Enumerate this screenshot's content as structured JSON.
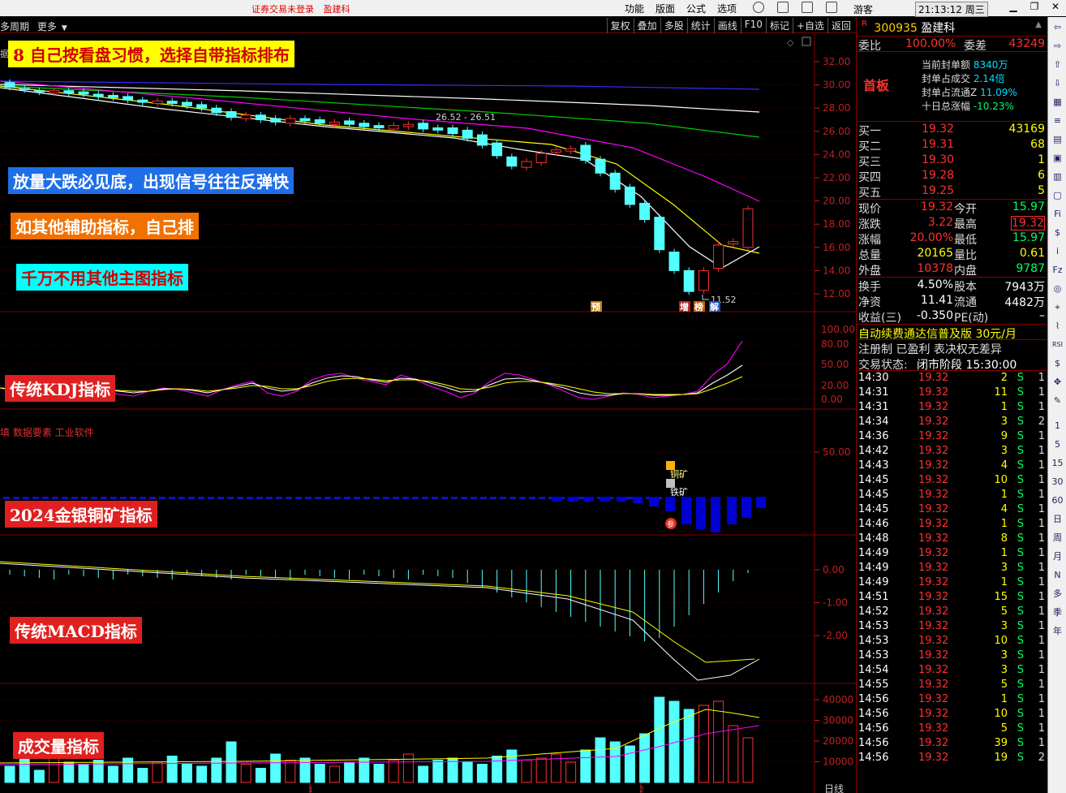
{
  "titlebar": {
    "status_text": "证券交易未登录",
    "stock_name": "盈建科",
    "menu": [
      "功能",
      "版面",
      "公式",
      "选项"
    ],
    "guest": "游客",
    "clock": "21:13:12 周三"
  },
  "toolbar": {
    "left": [
      "多周期",
      "更多"
    ],
    "right": [
      "复权",
      "叠加",
      "多股",
      "统计",
      "画线",
      "F10",
      "标记",
      "+自选",
      "返回"
    ]
  },
  "annotations": {
    "a8": "8  自己按看盘习惯，选择自带指标排布",
    "volume_drop": "放量大跌必见底，出现信号往往反弹快",
    "other_aux": "如其他辅助指标，自己排",
    "no_main": "千万不用其他主图指标",
    "kdj": "传统KDJ指标",
    "copper": "2024金银铜矿指标",
    "macd": "传统MACD指标",
    "vol": "成交量指标"
  },
  "chart_labels": {
    "main_partial": "据",
    "price_mark_top": "26.52 - 26.51",
    "price_mark_low": "11.52",
    "badges": [
      "预",
      "增",
      "榜",
      "解"
    ],
    "copper_source": "填 数据要素 工业软件",
    "copper_label": "铜矿",
    "iron_label": "铁矿",
    "ref_badge": "参",
    "axis_bottom": [
      "1",
      "2"
    ],
    "period": "日线"
  },
  "axes": {
    "main": [
      "32.00",
      "30.00",
      "28.00",
      "26.00",
      "24.00",
      "22.00",
      "20.00",
      "18.00",
      "16.00",
      "14.00",
      "12.00"
    ],
    "kdj": [
      "100.00",
      "80.00",
      "50.00",
      "20.00",
      "0.00"
    ],
    "copper": [
      "50.00"
    ],
    "macd": [
      "0.00",
      "-1.00",
      "-2.00"
    ],
    "vol": [
      "40000",
      "30000",
      "20000",
      "10000"
    ]
  },
  "panel": {
    "code": "300935",
    "name": "盈建科",
    "r_mark": "R",
    "weibi_label": "委比",
    "weibi": "100.00%",
    "weicha_label": "委差",
    "weicha": "43249",
    "first_board": "首板",
    "info": [
      {
        "k": "当前封单额",
        "v": "8340万"
      },
      {
        "k": "封单占成交",
        "v": "2.14倍"
      },
      {
        "k": "封单占流通Z",
        "v": "11.09%"
      },
      {
        "k": "十日总涨幅",
        "v": "-10.23%"
      }
    ],
    "bids": [
      {
        "k": "买一",
        "p": "19.32",
        "v": "43169"
      },
      {
        "k": "买二",
        "p": "19.31",
        "v": "68"
      },
      {
        "k": "买三",
        "p": "19.30",
        "v": "1"
      },
      {
        "k": "买四",
        "p": "19.28",
        "v": "6"
      },
      {
        "k": "买五",
        "p": "19.25",
        "v": "5"
      }
    ],
    "quote": [
      {
        "k1": "现价",
        "v1": "19.32",
        "k2": "今开",
        "v2": "15.97"
      },
      {
        "k1": "涨跌",
        "v1": "3.22",
        "k2": "最高",
        "v2": "19.32"
      },
      {
        "k1": "涨幅",
        "v1": "20.00%",
        "k2": "最低",
        "v2": "15.97"
      },
      {
        "k1": "总量",
        "v1": "20165",
        "k2": "量比",
        "v2": "0.61"
      },
      {
        "k1": "外盘",
        "v1": "10378",
        "k2": "内盘",
        "v2": "9787"
      }
    ],
    "stats": [
      {
        "k1": "换手",
        "v1": "4.50%",
        "k2": "股本",
        "v2": "7943万"
      },
      {
        "k1": "净资",
        "v1": "11.41",
        "k2": "流通",
        "v2": "4482万"
      },
      {
        "k1": "收益(三)",
        "v1": "-0.350",
        "k2": "PE(动)",
        "v2": "–"
      }
    ],
    "promo": "自动续费通达信普及版  30元/月",
    "reg": "注册制 已盈利 表决权无差异",
    "trade_state_label": "交易状态:",
    "trade_state": "闭市阶段 15:30:00",
    "ticks": [
      {
        "t": "14:30",
        "p": "19.32",
        "v": "2",
        "s": "S",
        "n": "1"
      },
      {
        "t": "14:31",
        "p": "19.32",
        "v": "11",
        "s": "S",
        "n": "1"
      },
      {
        "t": "14:31",
        "p": "19.32",
        "v": "1",
        "s": "S",
        "n": "1"
      },
      {
        "t": "14:34",
        "p": "19.32",
        "v": "3",
        "s": "S",
        "n": "2"
      },
      {
        "t": "14:36",
        "p": "19.32",
        "v": "9",
        "s": "S",
        "n": "1"
      },
      {
        "t": "14:42",
        "p": "19.32",
        "v": "3",
        "s": "S",
        "n": "1"
      },
      {
        "t": "14:43",
        "p": "19.32",
        "v": "4",
        "s": "S",
        "n": "1"
      },
      {
        "t": "14:45",
        "p": "19.32",
        "v": "10",
        "s": "S",
        "n": "1"
      },
      {
        "t": "14:45",
        "p": "19.32",
        "v": "1",
        "s": "S",
        "n": "1"
      },
      {
        "t": "14:45",
        "p": "19.32",
        "v": "4",
        "s": "S",
        "n": "1"
      },
      {
        "t": "14:46",
        "p": "19.32",
        "v": "1",
        "s": "S",
        "n": "1"
      },
      {
        "t": "14:48",
        "p": "19.32",
        "v": "8",
        "s": "S",
        "n": "1"
      },
      {
        "t": "14:49",
        "p": "19.32",
        "v": "1",
        "s": "S",
        "n": "1"
      },
      {
        "t": "14:49",
        "p": "19.32",
        "v": "3",
        "s": "S",
        "n": "1"
      },
      {
        "t": "14:49",
        "p": "19.32",
        "v": "1",
        "s": "S",
        "n": "1"
      },
      {
        "t": "14:51",
        "p": "19.32",
        "v": "15",
        "s": "S",
        "n": "1"
      },
      {
        "t": "14:52",
        "p": "19.32",
        "v": "5",
        "s": "S",
        "n": "1"
      },
      {
        "t": "14:53",
        "p": "19.32",
        "v": "3",
        "s": "S",
        "n": "1"
      },
      {
        "t": "14:53",
        "p": "19.32",
        "v": "10",
        "s": "S",
        "n": "1"
      },
      {
        "t": "14:53",
        "p": "19.32",
        "v": "3",
        "s": "S",
        "n": "1"
      },
      {
        "t": "14:54",
        "p": "19.32",
        "v": "3",
        "s": "S",
        "n": "1"
      },
      {
        "t": "14:55",
        "p": "19.32",
        "v": "5",
        "s": "S",
        "n": "1"
      },
      {
        "t": "14:56",
        "p": "19.32",
        "v": "1",
        "s": "S",
        "n": "1"
      },
      {
        "t": "14:56",
        "p": "19.32",
        "v": "10",
        "s": "S",
        "n": "1"
      },
      {
        "t": "14:56",
        "p": "19.32",
        "v": "5",
        "s": "S",
        "n": "1"
      },
      {
        "t": "14:56",
        "p": "19.32",
        "v": "39",
        "s": "S",
        "n": "1"
      },
      {
        "t": "14:56",
        "p": "19.32",
        "v": "19",
        "s": "S",
        "n": "2"
      }
    ]
  },
  "sidebar": [
    "1",
    "5",
    "15",
    "30",
    "60",
    "日",
    "周",
    "月",
    "N",
    "多",
    "季",
    "年"
  ],
  "colors": {
    "up": "#ff3030",
    "down": "#54ffff",
    "ma5": "#ffffff",
    "ma10": "#ffff00",
    "ma20": "#ff00ff",
    "ma60": "#00cc00",
    "ma120": "#ffffff",
    "ma250": "#3030ff"
  }
}
